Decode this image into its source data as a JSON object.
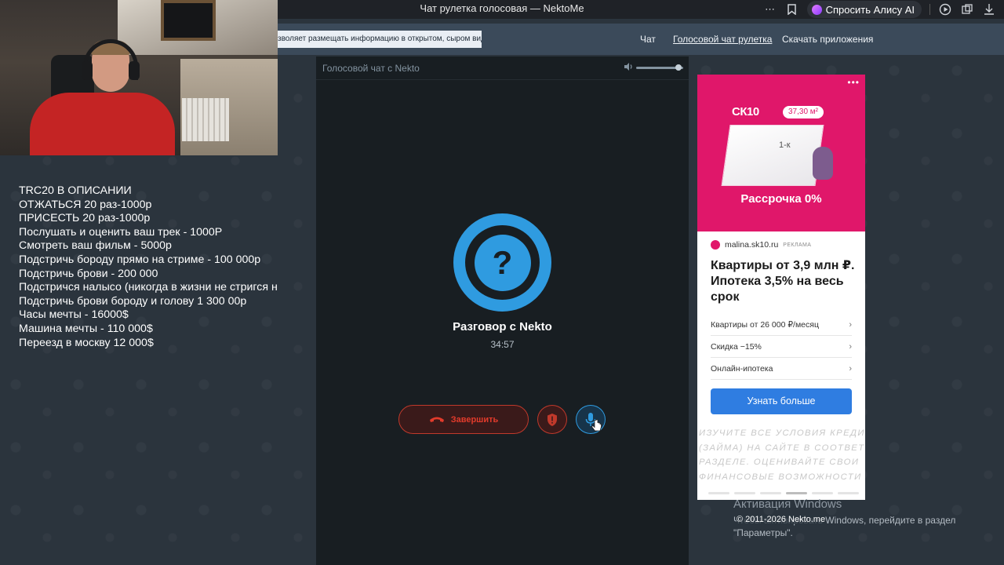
{
  "browser": {
    "title": "Чат рулетка голосовая — NektoMe",
    "alice_label": "Спросить Алису AI",
    "icons": [
      "more-icon",
      "bookmark-icon",
      "play-icon",
      "share-icon",
      "download-icon"
    ]
  },
  "site": {
    "warning_text": "зволяет размещать информацию в открытом, сыром виде!",
    "nav": [
      "Чат",
      "Голосовой чат рулетка",
      "Скачать приложения"
    ],
    "active_nav": "Голосовой чат рулетка"
  },
  "overlay": {
    "lines": [
      "TRC20 В ОПИСАНИИ",
      "ОТЖАТЬСЯ 20 раз-1000р",
      "ПРИСЕСТЬ 20 раз-1000р",
      "Послушать и оценить ваш трек - 1000Р",
      "Смотреть ваш фильм - 5000р",
      "Подстричь бороду прямо на стриме - 100 000р",
      "Подстричь брови - 200 000",
      "Подстричся налысо (никогда в жизни не стригся н",
      "Подстричь брови бороду и голову 1 300 00р",
      "Часы мечты - 16000$",
      "Машина мечты - 110 000$",
      "Переезд в москву 12 000$"
    ]
  },
  "chat": {
    "header_title": "Голосовой чат с Nekto",
    "volume_level": 0.9,
    "avatar_symbol": "?",
    "peer_name": "Разговор с Nekto",
    "timer": "34:57",
    "end_label": "Завершить",
    "accent_color": "#2f9be0",
    "danger_color": "#e23b2b"
  },
  "ad": {
    "logo": "СК10",
    "area_badge": "37,30 м²",
    "room_label": "1-к",
    "image_headline": "Рассрочка 0%",
    "source": "malina.sk10.ru",
    "badge": "РЕКЛАМА",
    "title": "Квартиры от 3,9 млн ₽. Ипотека 3,5% на весь срок",
    "rows": [
      "Квартиры от 26 000 ₽/месяц",
      "Скидка −15%",
      "Онлайн-ипотека"
    ],
    "cta": "Узнать больше",
    "disclaimer": [
      "ИЗУЧИТЕ ВСЕ УСЛОВИЯ КРЕДИТА",
      "(ЗАЙМА) НА САЙТЕ В СООТВЕТСТВУЮЩЕМ",
      "РАЗДЕЛЕ. ОЦЕНИВАЙТЕ СВОИ",
      "ФИНАНСОВЫЕ ВОЗМОЖНОСТИ И РИСКИ"
    ],
    "brand_color": "#e0176a",
    "cta_color": "#2f7de1"
  },
  "footer": {
    "windows_title": "Активация Windows",
    "windows_text": "Чтобы активировать Windows, перейдите в раздел \"Параметры\".",
    "copyright": "© 2011-2026 Nekto.me"
  }
}
